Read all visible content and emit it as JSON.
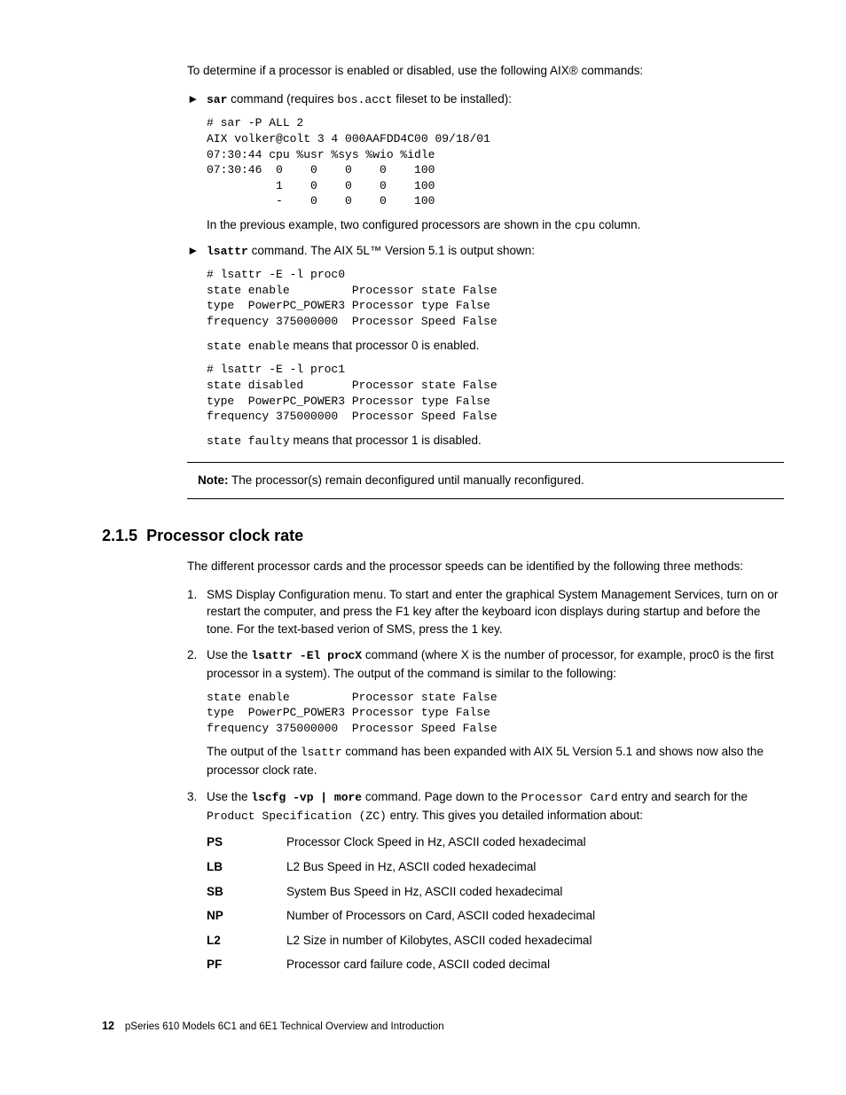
{
  "intro": "To determine if a processor is enabled or disabled, use the following AIX® commands:",
  "bullet1": {
    "cmd": "sar",
    "text_a": " command (requires ",
    "file": "bos.acct",
    "text_b": " fileset to be installed):",
    "code": "# sar -P ALL 2\nAIX volker@colt 3 4 000AAFDD4C00 09/18/01\n07:30:44 cpu %usr %sys %wio %idle\n07:30:46  0    0    0    0    100\n          1    0    0    0    100\n          -    0    0    0    100",
    "after_a": "In the previous example, two configured processors are shown in the ",
    "after_cpu": "cpu",
    "after_b": " column."
  },
  "bullet2": {
    "cmd": "lsattr",
    "text": " command. The AIX 5L™ Version 5.1 is output shown:",
    "code1": "# lsattr -E -l proc0\nstate enable         Processor state False\ntype  PowerPC_POWER3 Processor type False\nfrequency 375000000  Processor Speed False",
    "mid_a": "state enable",
    "mid_b": " means that processor 0 is enabled.",
    "code2": "# lsattr -E -l proc1\nstate disabled       Processor state False\ntype  PowerPC_POWER3 Processor type False\nfrequency 375000000  Processor Speed False",
    "end_a": "state faulty",
    "end_b": " means that processor 1 is disabled."
  },
  "note_label": "Note:",
  "note_text": " The processor(s) remain deconfigured until manually reconfigured.",
  "section_num": "2.1.5",
  "section_title": "Processor clock rate",
  "sec_intro": "The different processor cards and the processor speeds can be identified by the following three methods:",
  "m1": "SMS Display Configuration menu. To start and enter the graphical System Management Services, turn on or restart the computer, and press the F1 key after the keyboard icon displays during startup and before the tone. For the text-based verion of SMS, press the 1 key.",
  "m2": {
    "a": "Use the ",
    "cmd": "lsattr -El procX",
    "b": " command (where X is the number of processor, for example, proc0 is the first processor in a system). The output of the command is similar to the following:",
    "code": "state enable         Processor state False\ntype  PowerPC_POWER3 Processor type False\nfrequency 375000000  Processor Speed False",
    "c_a": "The output of the ",
    "c_cmd": "lsattr",
    "c_b": " command has been expanded with AIX 5L Version 5.1 and shows now also the processor clock rate."
  },
  "m3": {
    "a": "Use the ",
    "cmd": "lscfg -vp | more",
    "b": " command. Page down to the ",
    "pc": "Processor Card",
    "c": " entry and search for the ",
    "ps": "Product Specification (ZC)",
    "d": " entry. This gives you detailed information about:"
  },
  "dl": [
    {
      "t": "PS",
      "d": "Processor Clock Speed in Hz, ASCII coded hexadecimal"
    },
    {
      "t": "LB",
      "d": "L2 Bus Speed in Hz, ASCII coded hexadecimal"
    },
    {
      "t": "SB",
      "d": "System Bus Speed in Hz, ASCII coded hexadecimal"
    },
    {
      "t": "NP",
      "d": "Number of Processors on Card, ASCII coded hexadecimal"
    },
    {
      "t": "L2",
      "d": "L2 Size in number of Kilobytes, ASCII coded hexadecimal"
    },
    {
      "t": "PF",
      "d": "Processor card failure code, ASCII coded decimal"
    }
  ],
  "footer": {
    "page": "12",
    "title": "pSeries 610 Models 6C1 and 6E1 Technical Overview and Introduction"
  }
}
